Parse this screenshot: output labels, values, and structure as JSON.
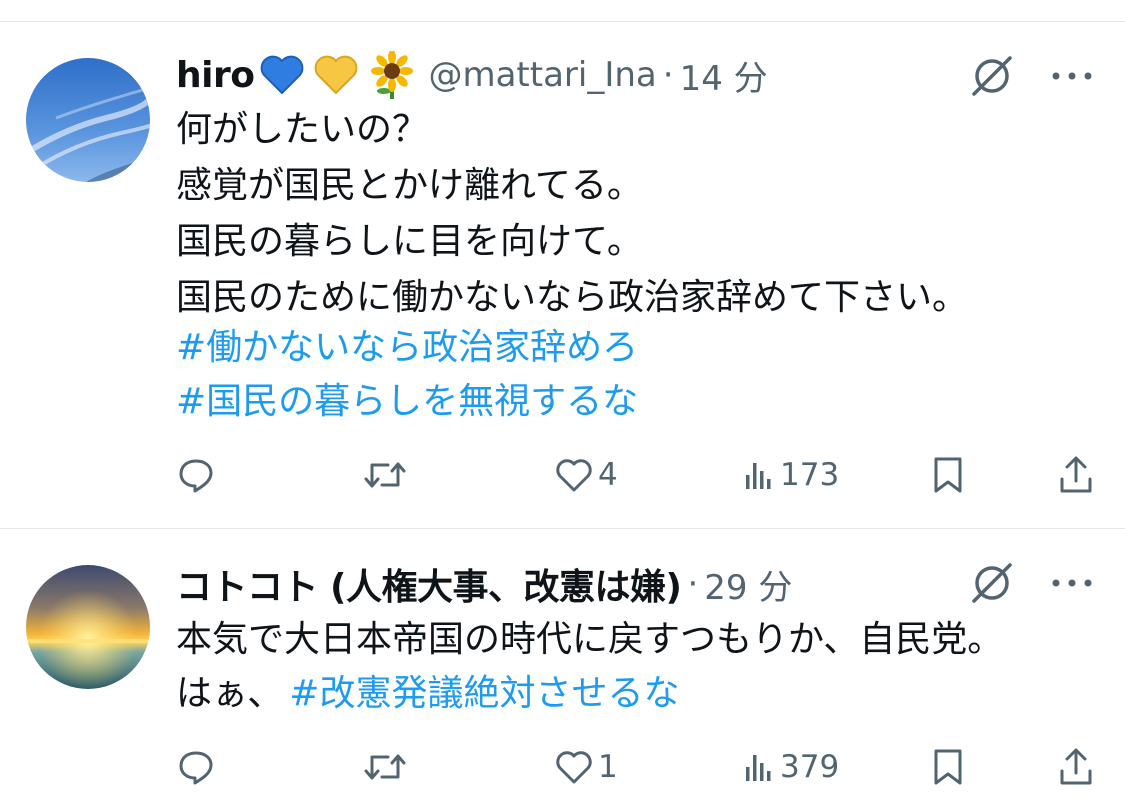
{
  "tweets": [
    {
      "display_name": "hiro",
      "name_emojis": [
        "💙",
        "💛",
        "🌻"
      ],
      "handle": "@mattari_Ina",
      "time": "14 分",
      "lines": [
        {
          "text": "何がしたいの？"
        },
        {
          "text": "感覚が国民とかけ離れてる。"
        },
        {
          "text": "国民の暮らしに目を向けて。"
        },
        {
          "text": "国民のために働かないなら政治家辞めて下さい。"
        },
        {
          "hashtag": "#働かないなら政治家辞めろ"
        },
        {
          "hashtag": "#国民の暮らしを無視するな"
        }
      ],
      "stats": {
        "replies": "",
        "retweets": "",
        "likes": "4",
        "views": "173"
      }
    },
    {
      "display_name": "コトコト (人権大事、改憲は嫌)",
      "handle": "",
      "time": "29 分",
      "lines": [
        {
          "text": "本気で大日本帝国の時代に戻すつもりか、自民党。"
        },
        {
          "text": "はぁ、",
          "hashtag": "#改憲発議絶対させるな"
        }
      ],
      "stats": {
        "replies": "",
        "retweets": "",
        "likes": "1",
        "views": "379"
      }
    }
  ],
  "icons": {
    "reply": "reply-icon",
    "retweet": "retweet-icon",
    "like": "heart-icon",
    "views": "views-icon",
    "bookmark": "bookmark-icon",
    "share": "share-icon",
    "grok": "grok-icon",
    "more": "more-icon"
  },
  "colors": {
    "hashtag": "#1d9bf0",
    "secondary_text": "#536471",
    "divider": "#e6e9ec"
  }
}
